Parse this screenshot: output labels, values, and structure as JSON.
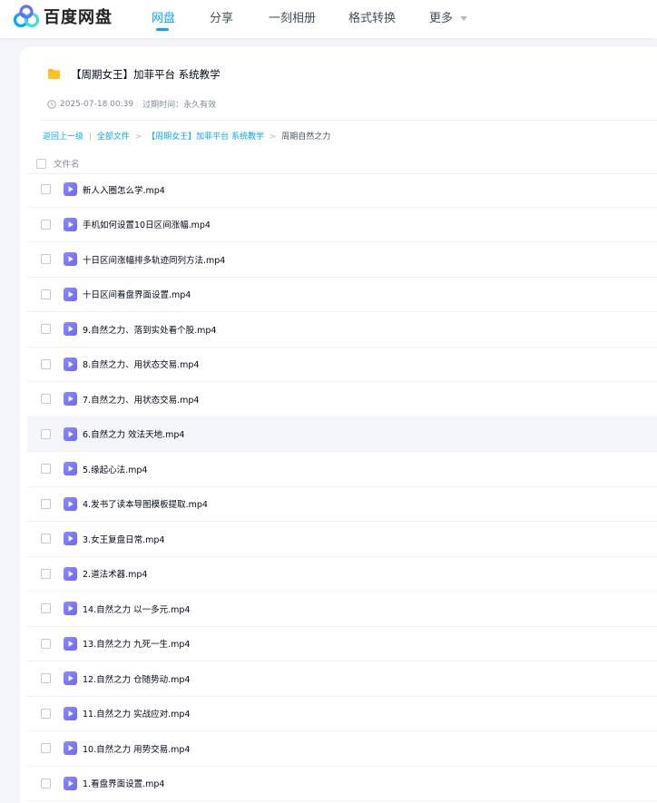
{
  "brand": {
    "name": "百度网盘",
    "colors": {
      "accent": "#06a7ff",
      "logo_blue": "#06a7ff",
      "logo_teal": "#3ee0c8",
      "logo_purple": "#6c6cf7"
    }
  },
  "nav": {
    "items": [
      {
        "label": "网盘",
        "active": true
      },
      {
        "label": "分享",
        "active": false
      },
      {
        "label": "一刻相册",
        "active": false
      },
      {
        "label": "格式转换",
        "active": false
      },
      {
        "label": "更多",
        "active": false,
        "icon": "chevron-down-icon"
      }
    ]
  },
  "share": {
    "icon": "folder-icon",
    "title": "【周期女王】加菲平台 系统教学",
    "date": "2025-07-18 00:39",
    "expire_label": "过期时间：永久有效"
  },
  "breadcrumb": {
    "back": "返回上一级",
    "separator_bar": "|",
    "all_files": "全部文件",
    "arrow": ">",
    "folder": "【周期女王】加菲平台 系统教学",
    "current": "周期自然之力"
  },
  "table": {
    "column_header": "文件名",
    "files": [
      {
        "name": "新人入圈怎么学.mp4",
        "icon": "video-file-icon"
      },
      {
        "name": "手机如何设置10日区间涨幅.mp4",
        "icon": "video-file-icon"
      },
      {
        "name": "十日区间涨幅排多轨迹同列方法.mp4",
        "icon": "video-file-icon"
      },
      {
        "name": "十日区间看盘界面设置.mp4",
        "icon": "video-file-icon"
      },
      {
        "name": "9.自然之力、落到实处看个股.mp4",
        "icon": "video-file-icon"
      },
      {
        "name": "8.自然之力、用状态交易.mp4",
        "icon": "video-file-icon"
      },
      {
        "name": "7.自然之力、用状态交易.mp4",
        "icon": "video-file-icon"
      },
      {
        "name": "6.自然之力 效法天地.mp4",
        "icon": "video-file-icon",
        "hover": true
      },
      {
        "name": "5.缘起心法.mp4",
        "icon": "video-file-icon"
      },
      {
        "name": "4.发书了读本导图模板提取.mp4",
        "icon": "video-file-icon"
      },
      {
        "name": "3.女王复盘日常.mp4",
        "icon": "video-file-icon"
      },
      {
        "name": "2.道法术器.mp4",
        "icon": "video-file-icon"
      },
      {
        "name": "14.自然之力 以一多元.mp4",
        "icon": "video-file-icon"
      },
      {
        "name": "13.自然之力 九死一生.mp4",
        "icon": "video-file-icon"
      },
      {
        "name": "12.自然之力 仓随势动.mp4",
        "icon": "video-file-icon"
      },
      {
        "name": "11.自然之力 实战应对.mp4",
        "icon": "video-file-icon"
      },
      {
        "name": "10.自然之力 用势交易.mp4",
        "icon": "video-file-icon"
      },
      {
        "name": "1.看盘界面设置.mp4",
        "icon": "video-file-icon"
      }
    ]
  }
}
